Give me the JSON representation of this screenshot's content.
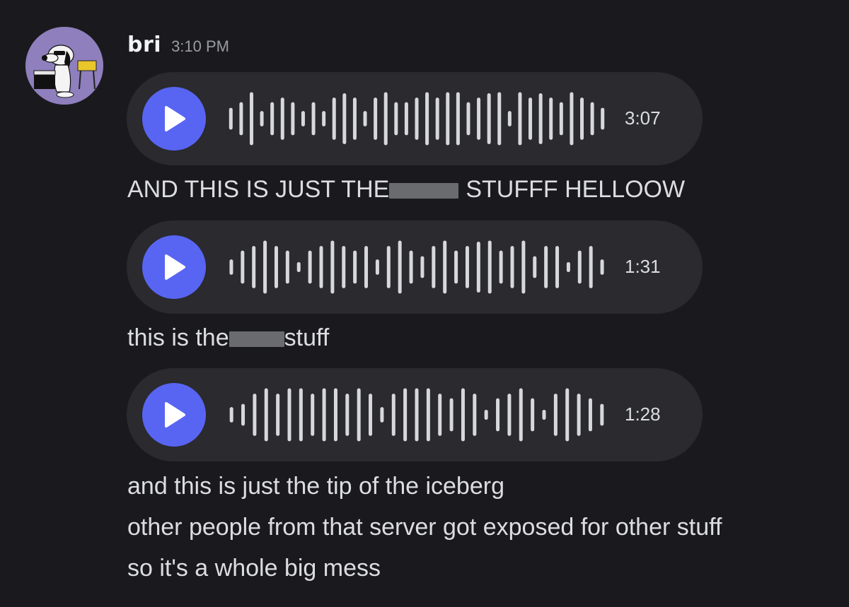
{
  "author": {
    "name": "bri",
    "timestamp": "3:10 PM"
  },
  "voice_messages": [
    {
      "duration": "3:07",
      "bars": [
        0.34,
        0.55,
        0.92,
        0.22,
        0.55,
        0.72,
        0.55,
        0.22,
        0.55,
        0.22,
        0.72,
        0.88,
        0.72,
        0.22,
        0.72,
        0.92,
        0.55,
        0.55,
        0.72,
        0.92,
        0.72,
        0.92,
        0.92,
        0.55,
        0.72,
        0.88,
        0.92,
        0.22,
        0.92,
        0.72,
        0.88,
        0.72,
        0.55,
        0.92,
        0.72,
        0.55,
        0.34
      ]
    },
    {
      "duration": "1:31",
      "bars": [
        0.22,
        0.55,
        0.72,
        0.92,
        0.72,
        0.55,
        0.12,
        0.55,
        0.72,
        0.92,
        0.72,
        0.55,
        0.72,
        0.22,
        0.72,
        0.92,
        0.55,
        0.34,
        0.72,
        0.92,
        0.55,
        0.72,
        0.88,
        0.92,
        0.55,
        0.72,
        0.92,
        0.34,
        0.72,
        0.72,
        0.12,
        0.55,
        0.72,
        0.22
      ]
    },
    {
      "duration": "1:28",
      "bars": [
        0.22,
        0.34,
        0.72,
        0.92,
        0.72,
        0.92,
        0.92,
        0.72,
        0.92,
        0.92,
        0.72,
        0.92,
        0.72,
        0.22,
        0.72,
        0.92,
        0.92,
        0.92,
        0.72,
        0.55,
        0.92,
        0.72,
        0.12,
        0.55,
        0.72,
        0.92,
        0.55,
        0.12,
        0.72,
        0.92,
        0.72,
        0.55,
        0.34
      ]
    }
  ],
  "captions": {
    "first_before": "AND THIS IS JUST THE",
    "first_after": "STUFFF HELLOOW",
    "second_before": "this is the",
    "second_after": "stuff"
  },
  "final_lines": [
    "and this is just the tip of the iceberg",
    "other people from that server got exposed for other stuff",
    "so it's a whole big mess"
  ]
}
